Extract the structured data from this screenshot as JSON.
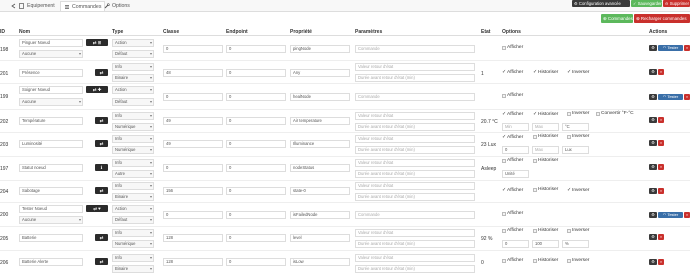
{
  "tabs": [
    {
      "label": "Equipement"
    },
    {
      "label": "Commandes"
    },
    {
      "label": "Options"
    }
  ],
  "top_buttons": {
    "config": "Configuration avancée",
    "save": "Sauvegarder",
    "delete": "Supprimer"
  },
  "actions": {
    "commandes": "Commandes",
    "reload": "Recharger commandes"
  },
  "headers": {
    "id": "ID",
    "nom": "Nom",
    "type": "Type",
    "classe": "Classe",
    "endpoint": "Endpoint",
    "propriete": "Propriété",
    "parametres": "Paramètres",
    "etat": "Etat",
    "options": "Options",
    "actions": "Actions"
  },
  "labels": {
    "afficher": "Afficher",
    "historiser": "Historiser",
    "inverser": "Inverser",
    "convertir": "Convertir °F-°C",
    "tester": "Tester",
    "commande": "Commande",
    "valeur_retour": "Valeur retour d'état",
    "duree_retour": "Durée avant retour d'état (min)",
    "min": "Min",
    "max": "Max",
    "unite": "Unité",
    "c_unit": "°C",
    "lux": "Lux",
    "pct": "%"
  },
  "rows": [
    {
      "id": "198",
      "nom": "Pinguer Noeud",
      "sub": "Aucune",
      "type": "Action",
      "subtype": "Défaut",
      "classe": "0",
      "endpoint": "0",
      "prop": "pingNode",
      "etat": ""
    },
    {
      "id": "201",
      "nom": "Présence",
      "sub": "",
      "type": "Info",
      "subtype": "Binaire",
      "classe": "48",
      "endpoint": "0",
      "prop": "Any",
      "etat": "1"
    },
    {
      "id": "199",
      "nom": "Soigner Noeud",
      "sub": "Aucune",
      "type": "Action",
      "subtype": "Défaut",
      "classe": "0",
      "endpoint": "0",
      "prop": "healNode",
      "etat": ""
    },
    {
      "id": "202",
      "nom": "Température",
      "sub": "",
      "type": "Info",
      "subtype": "Numérique",
      "classe": "49",
      "endpoint": "0",
      "prop": "Air temperature",
      "etat": "20.7 °C"
    },
    {
      "id": "203",
      "nom": "Luminosité",
      "sub": "",
      "type": "Info",
      "subtype": "Numérique",
      "classe": "49",
      "endpoint": "0",
      "prop": "Illuminance",
      "etat": "23 Lux"
    },
    {
      "id": "197",
      "nom": "Statut noeud",
      "sub": "",
      "type": "Info",
      "subtype": "Autre",
      "classe": "0",
      "endpoint": "0",
      "prop": "nodeStatus",
      "etat": "Asleep"
    },
    {
      "id": "204",
      "nom": "Sabotage",
      "sub": "",
      "type": "Info",
      "subtype": "Binaire",
      "classe": "156",
      "endpoint": "0",
      "prop": "state-0",
      "etat": ""
    },
    {
      "id": "200",
      "nom": "Tester Noeud",
      "sub": "Aucune",
      "type": "Action",
      "subtype": "Défaut",
      "classe": "0",
      "endpoint": "0",
      "prop": "isFailedNode",
      "etat": ""
    },
    {
      "id": "205",
      "nom": "Batterie",
      "sub": "",
      "type": "Info",
      "subtype": "Numérique",
      "classe": "128",
      "endpoint": "0",
      "prop": "level",
      "etat": "92 %"
    },
    {
      "id": "206",
      "nom": "Batterie Alerte",
      "sub": "",
      "type": "Info",
      "subtype": "Binaire",
      "classe": "128",
      "endpoint": "0",
      "prop": "isLow",
      "etat": "0"
    }
  ],
  "battery_opts": {
    "min": "0",
    "max": "100"
  },
  "colors": {
    "config": "#3a3a3a",
    "save": "#5cb85c",
    "delete": "#c9302c",
    "commandes": "#5cb85c",
    "reload": "#c9302c"
  }
}
